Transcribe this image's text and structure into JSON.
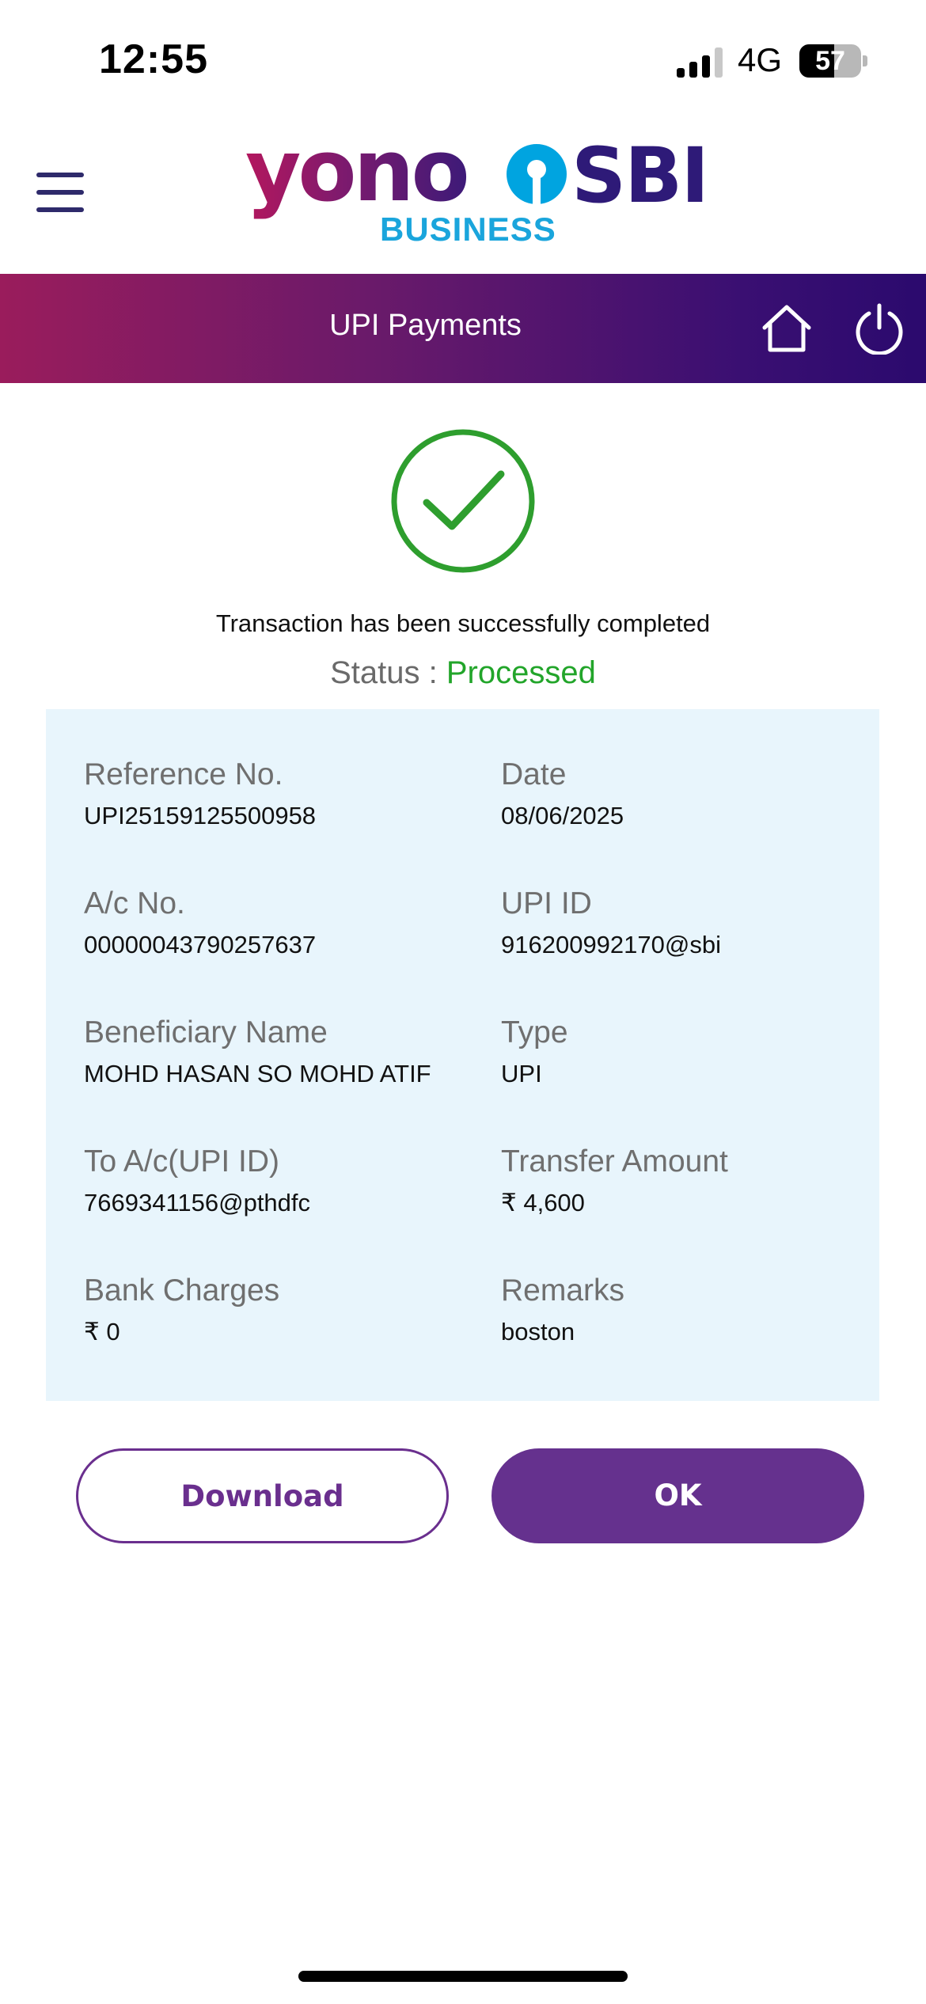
{
  "status_bar": {
    "time": "12:55",
    "network": "4G",
    "battery": "57"
  },
  "header": {
    "logo_yono": "yono",
    "logo_sbi": "SBI",
    "logo_business": "BUSINESS",
    "page_title": "UPI Payments"
  },
  "result": {
    "message": "Transaction has been successfully completed",
    "status_label": "Status : ",
    "status_value": "Processed",
    "status_color": "#22a52a"
  },
  "details": {
    "reference_label": "Reference No.",
    "reference_value": "UPI25159125500958",
    "date_label": "Date",
    "date_value": "08/06/2025",
    "account_label": "A/c No.",
    "account_value": "00000043790257637",
    "upi_id_label": "UPI ID",
    "upi_id_value": "916200992170@sbi",
    "beneficiary_label": "Beneficiary Name",
    "beneficiary_value": "MOHD HASAN SO MOHD ATIF",
    "type_label": "Type",
    "type_value": "UPI",
    "to_account_label": "To A/c(UPI ID)",
    "to_account_value": "7669341156@pthdfc",
    "amount_label": "Transfer Amount",
    "amount_value": "₹ 4,600",
    "charges_label": "Bank Charges",
    "charges_value": "₹ 0",
    "remarks_label": "Remarks",
    "remarks_value": "boston"
  },
  "actions": {
    "download_label": "Download",
    "ok_label": "OK"
  },
  "colors": {
    "brand_purple": "#65318e",
    "card_background": "#e8f5fc",
    "success_green": "#22a52a"
  }
}
